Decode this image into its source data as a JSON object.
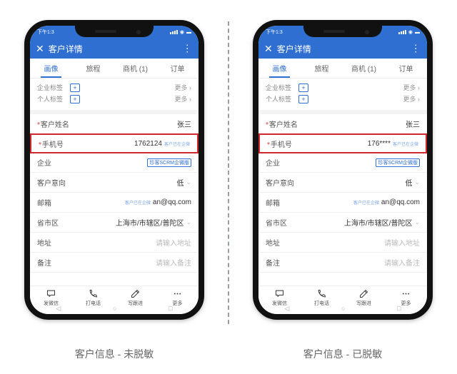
{
  "captions": {
    "left": "客户信息 - 未脱敏",
    "right": "客户信息 - 已脱敏"
  },
  "statusbar": {
    "time": "下午1:3"
  },
  "titlebar": {
    "title": "客户详情"
  },
  "tabs": [
    "画像",
    "旅程",
    "商机 (1)",
    "订单"
  ],
  "tagSection": {
    "enterprise": "企业标签",
    "personal": "个人标签",
    "more": "更多 ›"
  },
  "rows": {
    "name": {
      "label": "客户姓名",
      "value": "张三",
      "required": true
    },
    "phone": {
      "label": "手机号",
      "required": true,
      "value_left": "1762124",
      "value_right": "176****",
      "badge": "客户已在企微"
    },
    "company": {
      "label": "企业",
      "badge": "珍客SCRM企微版"
    },
    "intent": {
      "label": "客户意向",
      "value": "低"
    },
    "email": {
      "label": "邮箱",
      "value": "an@qq.com",
      "badge": "客户已在企微"
    },
    "region": {
      "label": "省市区",
      "value": "上海市/市辖区/普陀区"
    },
    "address": {
      "label": "地址",
      "placeholder": "请输入地址"
    },
    "remark": {
      "label": "备注",
      "placeholder": "请输入备注"
    }
  },
  "bottombar": {
    "wechat": "发微信",
    "call": "打电话",
    "followup": "写跟进",
    "more": "更多"
  }
}
